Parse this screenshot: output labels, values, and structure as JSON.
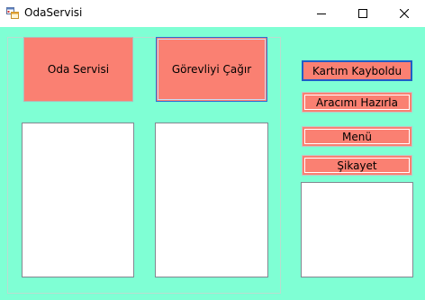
{
  "window": {
    "title": "OdaServisi",
    "app_icon": "form-app-icon",
    "controls": [
      "minimize-icon",
      "maximize-icon",
      "close-icon"
    ]
  },
  "buttons": {
    "room_service": "Oda Servisi",
    "call_staff": "Görevliyi Çağır",
    "lost_card": "Kartım Kayboldu",
    "prepare_car": "Aracımı Hazırla",
    "menu": "Menü",
    "complaint": "Şikayet"
  },
  "lists": {
    "room_service_items": [],
    "staff_call_items": [],
    "side_items": []
  },
  "colors": {
    "form_background": "#7fffd4",
    "button_background": "#fa8072",
    "list_background": "#ffffff",
    "focus_border": "#1f5ec8"
  }
}
